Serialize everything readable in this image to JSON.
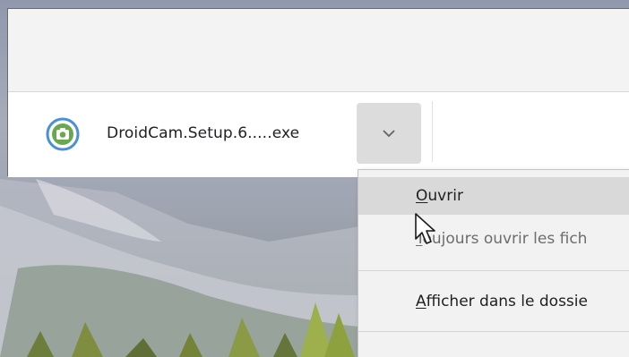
{
  "download": {
    "file_name": "DroidCam.Setup.6.....exe",
    "icon": "droidcam-app-icon"
  },
  "dropdown": {
    "icon": "chevron-down-icon"
  },
  "context_menu": {
    "items": [
      {
        "mnemonic": "O",
        "rest": "uvrir"
      },
      {
        "mnemonic": "T",
        "rest": "oujours ouvrir les fich"
      },
      {
        "mnemonic": "A",
        "rest": "fficher dans le dossie"
      }
    ]
  },
  "colors": {
    "icon_ring": "#4a90d9",
    "icon_body": "#6aa84f",
    "menu_highlight": "#d9d9d9"
  }
}
